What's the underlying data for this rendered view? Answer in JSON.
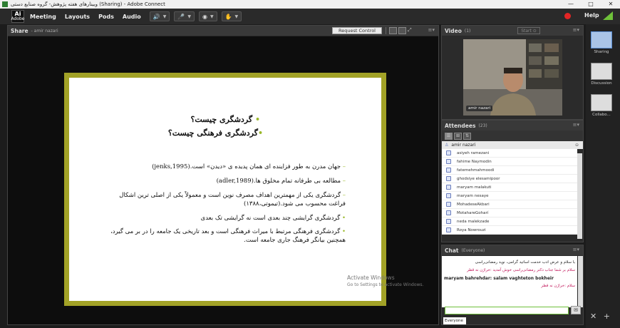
{
  "window": {
    "title": "وبینارهای هفته پژوهش- گروه صنایع دستی (Sharing) - Adobe Connect",
    "minimize": "—",
    "maximize": "□",
    "close": "✕"
  },
  "menubar": {
    "logo_top": "Adobe",
    "logo_bottom": "Ai",
    "items": [
      "Meeting",
      "Layouts",
      "Pods",
      "Audio"
    ],
    "help": "Help",
    "colors": {
      "accent_green": "#6fc23a",
      "record_red": "#e32525"
    }
  },
  "share": {
    "title": "Share",
    "presenter": "- amir nazari",
    "request_control": "Request Control",
    "slide": {
      "title1": "گردشگری چیست؟",
      "title2": "گردشگری فرهنگی چیست؟",
      "bullets": [
        "جهان مدرن به طور فزاینده ای همان پدیده ی «دیدن» است.(jenks,1995)",
        "مطالعه بی طرفانه تمام مخلوق ها.(adler,1989)",
        "گردشگری یکی از مهمترین اهداف مصرف نوین است و معمولاً یکی از اصلی ترین اشکال فراغت محسوب می شود.(تیموتی،۱۳۸۸)",
        "گردشگری گرایشی چند بعدی است نه گرایشی تک بعدی",
        "گردشگری فرهنگی مرتبط با میراث فرهنگی است و بعد تاریخی یک جامعه را در بر می گیرد، همچنین بیانگر فرهنگ جاری جامعه است."
      ],
      "frame_color": "#a2a227"
    },
    "watermark": {
      "line1": "Activate Windows",
      "line2": "Go to Settings to activate Windows."
    }
  },
  "video": {
    "title": "Video",
    "count": "(1)",
    "start": "Start",
    "camera_name": "amir nazari"
  },
  "attendees": {
    "title": "Attendees",
    "count": "(23)",
    "host": "amir nazari",
    "list": [
      "asiyeh ramezani",
      "fahime Naymodin",
      "fatemehmahmoodi",
      "ghodsiye elesamipoor",
      "maryam malakuti",
      "maryam nesaye",
      "MohadeseAkbari",
      "MotahareGoharí",
      "neda malekzade",
      "Roya Nowrouzi"
    ]
  },
  "chat": {
    "title": "Chat",
    "audience": "(Everyone)",
    "messages": [
      {
        "text": "با سلام و عرض ادب خدمت اساتید گرامی، نوید رمضانی‌راسی",
        "color": "#222"
      },
      {
        "text": "سلام بر شما جناب دکتر رمضانی‌راسی خوش آمدید :خراژن نه قطر",
        "color": "#c2185b"
      },
      {
        "text": "maryam bahrehdar: salam vaghteton bokheir",
        "color": "#111"
      },
      {
        "text": "سلام :خراژن نه قطر",
        "color": "#c2185b"
      }
    ],
    "send": "✉",
    "recipient": "Everyone"
  },
  "sidebar": {
    "items": [
      "Sharing",
      "Discussion",
      "Collabo..."
    ]
  }
}
